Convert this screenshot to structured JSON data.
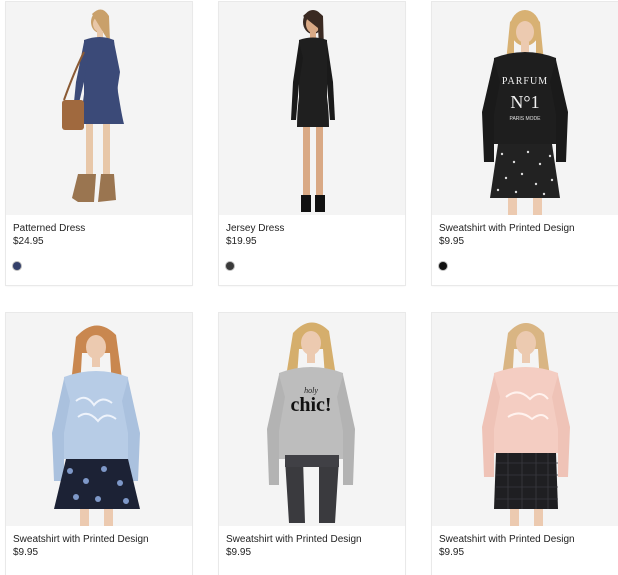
{
  "products": [
    {
      "name": "Patterned Dress",
      "price": "$24.95",
      "swatch_color": "#34406a",
      "icon": "patterned-dress-photo"
    },
    {
      "name": "Jersey Dress",
      "price": "$19.95",
      "swatch_color": "#3a3a3a",
      "icon": "jersey-dress-photo"
    },
    {
      "name": "Sweatshirt with Printed Design",
      "price": "$9.95",
      "swatch_color": "#111111",
      "icon": "parfum-sweatshirt-photo",
      "print": {
        "line1": "PARFUM",
        "line2": "N°1",
        "line3": "PARIS MODE"
      }
    },
    {
      "name": "Sweatshirt with Printed Design",
      "price": "$9.95",
      "swatch_color": "#9db6d8",
      "icon": "blue-sweatshirt-photo"
    },
    {
      "name": "Sweatshirt with Printed Design",
      "price": "$9.95",
      "swatch_color": "#b9b9b9",
      "icon": "chic-sweatshirt-photo",
      "print": {
        "line1": "holy",
        "line2": "chic!"
      }
    },
    {
      "name": "Sweatshirt with Printed Design",
      "price": "$9.95",
      "swatch_color": "#f1c8bd",
      "icon": "pink-sweatshirt-photo"
    }
  ]
}
